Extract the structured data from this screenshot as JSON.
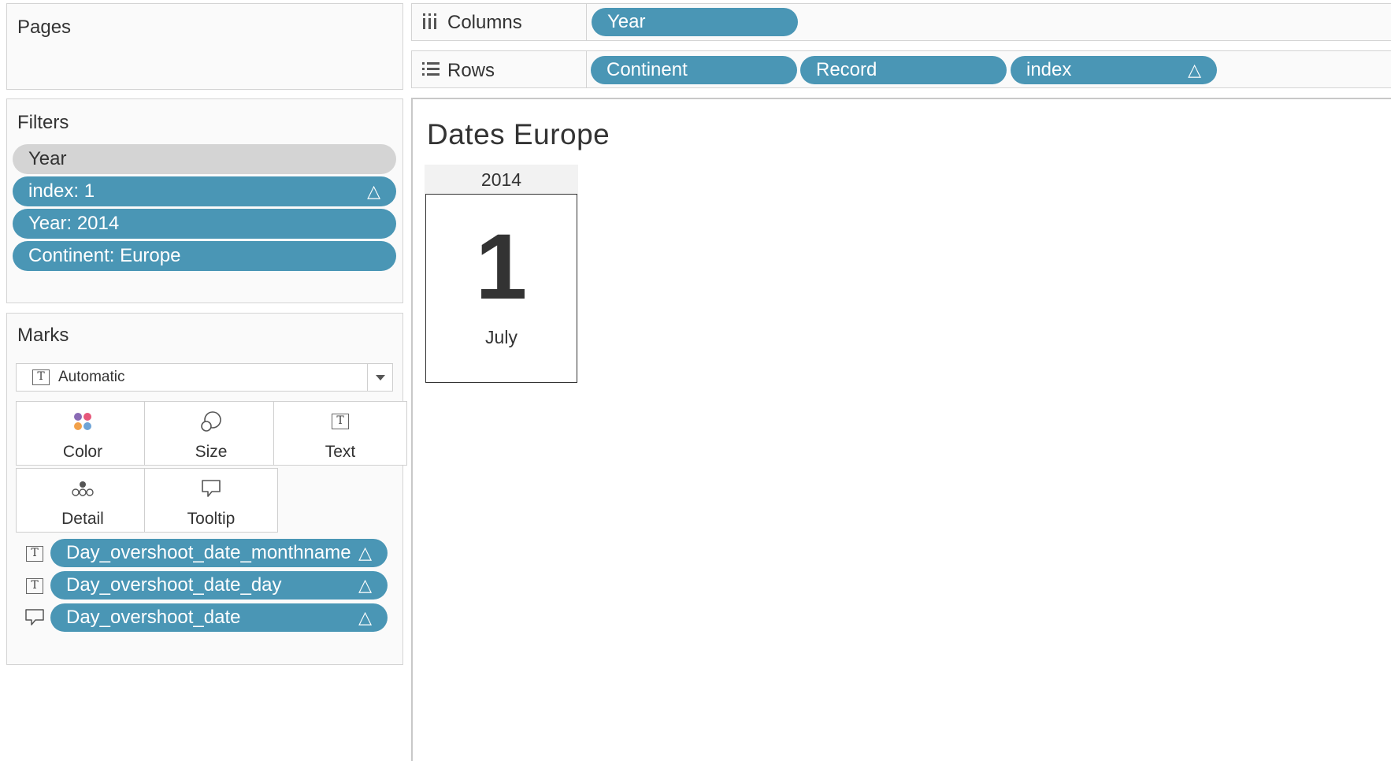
{
  "pages": {
    "title": "Pages"
  },
  "filters": {
    "title": "Filters",
    "items": [
      {
        "label": "Year",
        "style": "grey",
        "calc": false
      },
      {
        "label": "index: 1",
        "style": "blue",
        "calc": true
      },
      {
        "label": "Year: 2014",
        "style": "blue",
        "calc": false
      },
      {
        "label": "Continent: Europe",
        "style": "blue",
        "calc": false
      }
    ]
  },
  "marks": {
    "title": "Marks",
    "mark_type": "Automatic",
    "buttons": {
      "color": "Color",
      "size": "Size",
      "text": "Text",
      "detail": "Detail",
      "tooltip": "Tooltip"
    },
    "fields": [
      {
        "label": "Day_overshoot_date_monthname",
        "icon": "text-icon",
        "calc": true
      },
      {
        "label": "Day_overshoot_date_day",
        "icon": "text-icon",
        "calc": true
      },
      {
        "label": "Day_overshoot_date",
        "icon": "tooltip-icon",
        "calc": true
      }
    ]
  },
  "shelves": {
    "columns": {
      "label": "Columns",
      "pills": [
        {
          "label": "Year",
          "calc": false
        }
      ]
    },
    "rows": {
      "label": "Rows",
      "pills": [
        {
          "label": "Continent",
          "calc": false
        },
        {
          "label": "Record",
          "calc": false
        },
        {
          "label": "index",
          "calc": true
        }
      ]
    }
  },
  "view": {
    "title": "Dates Europe",
    "column_header": "2014",
    "day": "1",
    "month": "July"
  },
  "symbols": {
    "calc": "△"
  },
  "colors": {
    "pill": "#4a96b5",
    "filter_grey": "#d4d4d4"
  }
}
